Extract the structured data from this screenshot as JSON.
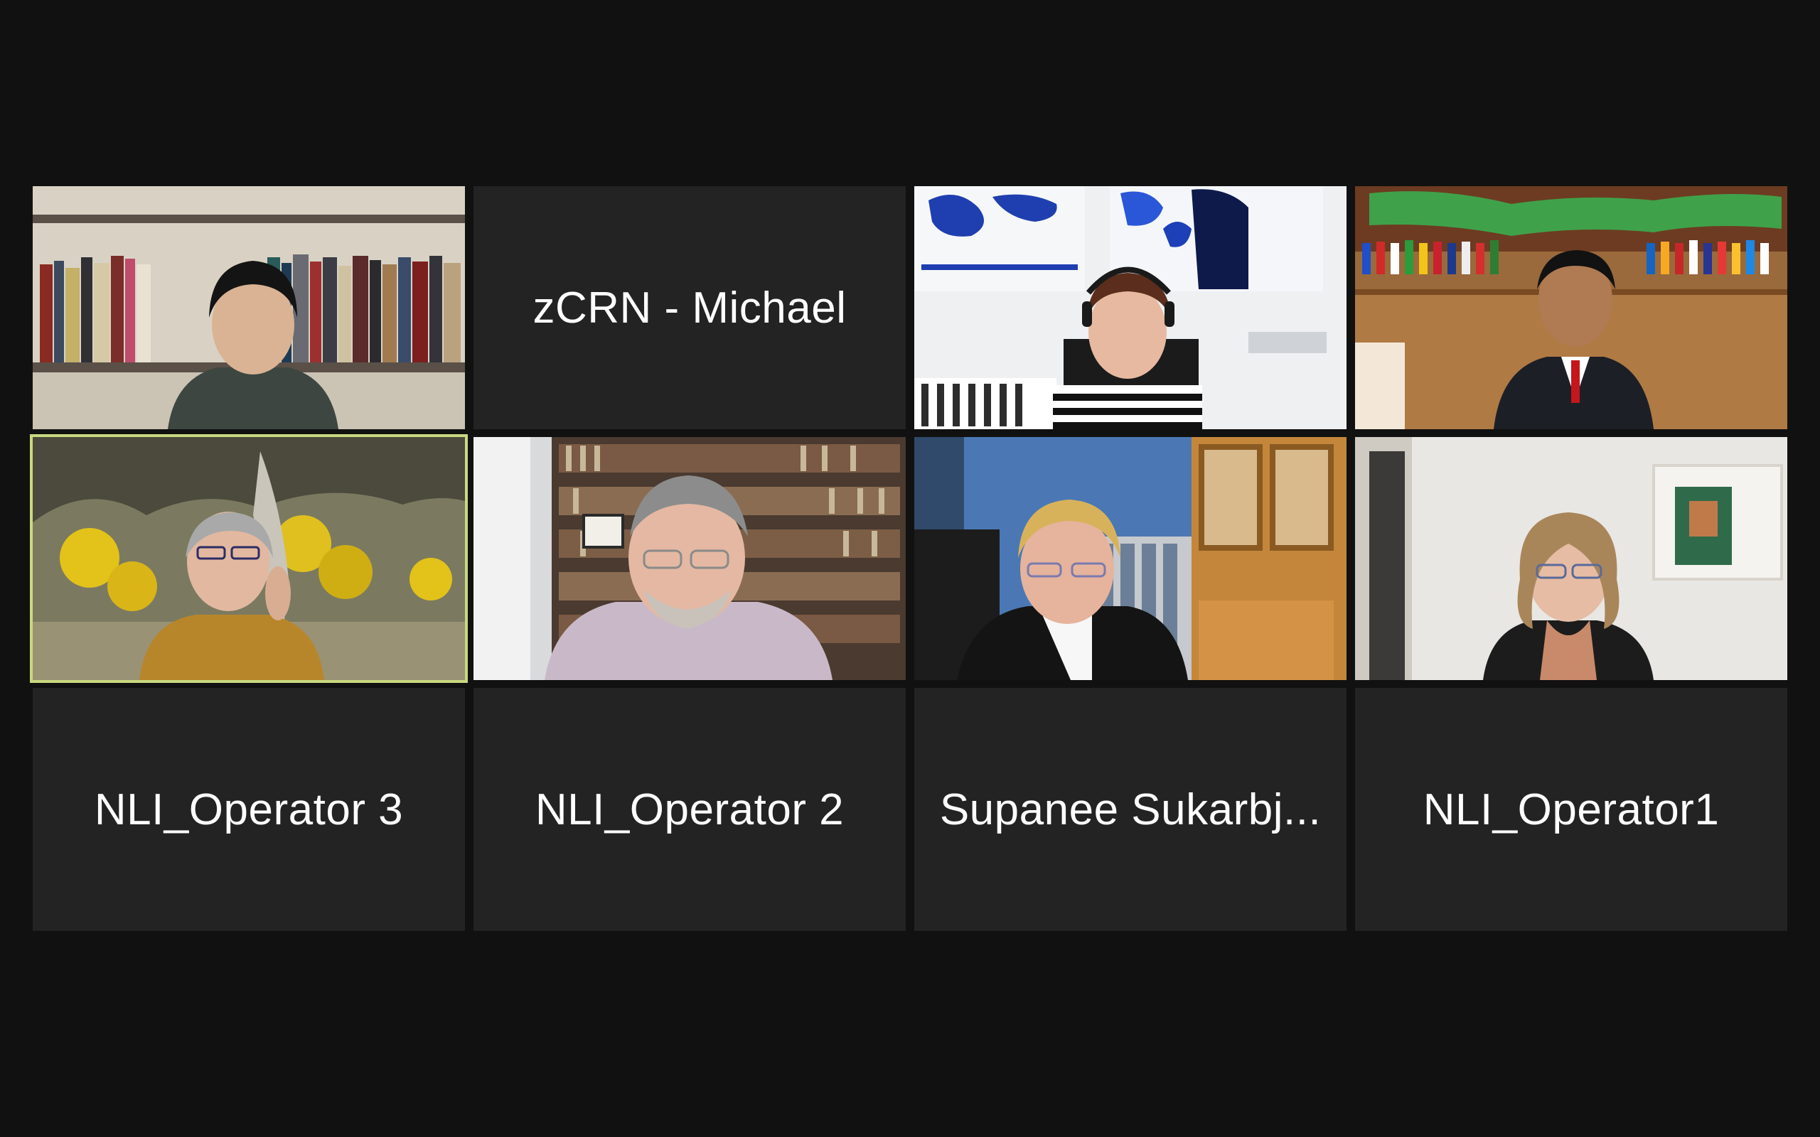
{
  "meeting": {
    "view": "gallery",
    "participants": [
      {
        "id": "p1",
        "display_name": "",
        "video": true,
        "active_speaker": false
      },
      {
        "id": "p2",
        "display_name": "zCRN - Michael",
        "video": false,
        "active_speaker": false
      },
      {
        "id": "p3",
        "display_name": "",
        "video": true,
        "active_speaker": false
      },
      {
        "id": "p4",
        "display_name": "",
        "video": true,
        "active_speaker": false
      },
      {
        "id": "p5",
        "display_name": "",
        "video": true,
        "active_speaker": true
      },
      {
        "id": "p6",
        "display_name": "",
        "video": true,
        "active_speaker": false
      },
      {
        "id": "p7",
        "display_name": "",
        "video": true,
        "active_speaker": false
      },
      {
        "id": "p8",
        "display_name": "",
        "video": true,
        "active_speaker": false
      },
      {
        "id": "p9",
        "display_name": "NLI_Operator 3",
        "video": false,
        "active_speaker": false
      },
      {
        "id": "p10",
        "display_name": "NLI_Operator 2",
        "video": false,
        "active_speaker": false
      },
      {
        "id": "p11",
        "display_name": "Supanee Sukarbj...",
        "video": false,
        "active_speaker": false
      },
      {
        "id": "p12",
        "display_name": "NLI_Operator1",
        "video": false,
        "active_speaker": false
      }
    ]
  },
  "colors": {
    "background": "#111111",
    "tile": "#232323",
    "active_speaker_border": "#c9d980",
    "name_text": "#ffffff"
  }
}
